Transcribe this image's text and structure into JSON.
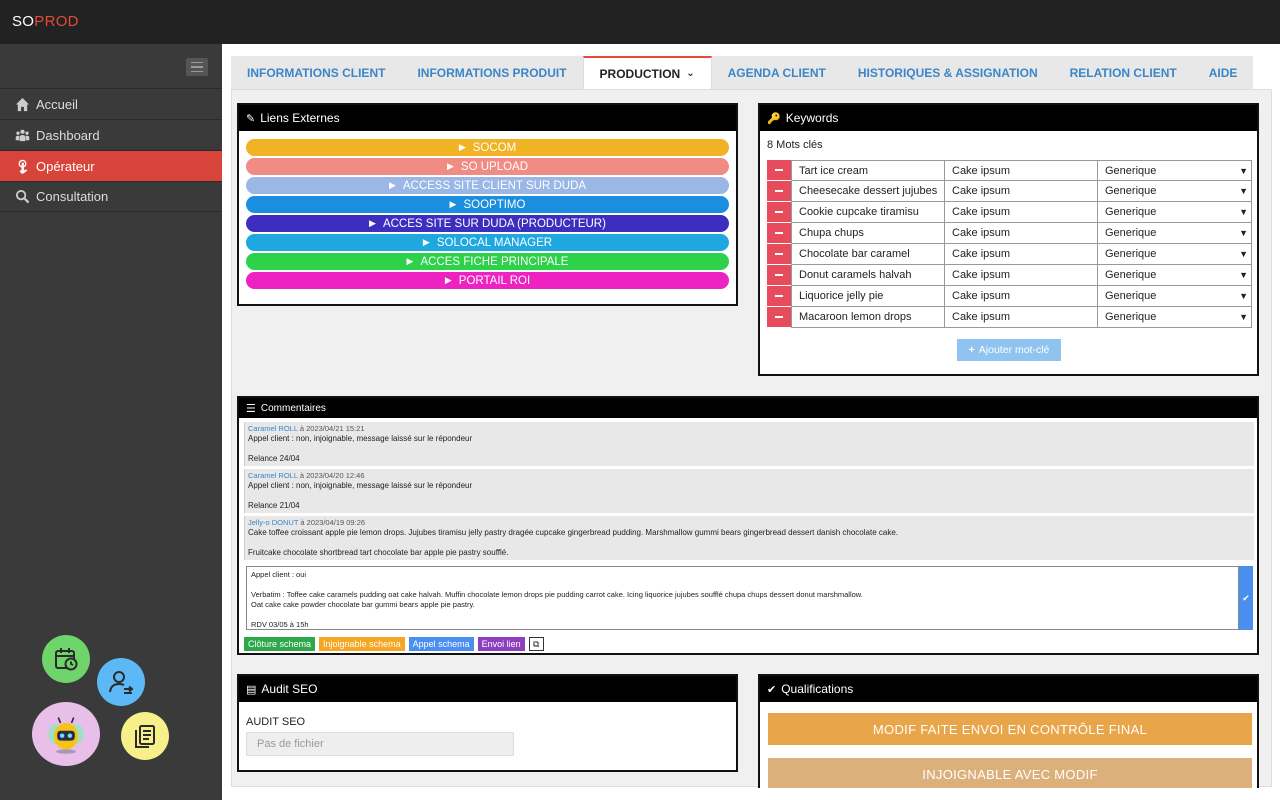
{
  "app": {
    "logo_so": "SO",
    "logo_prod": "PROD"
  },
  "sidebar": {
    "items": [
      {
        "label": "Accueil",
        "icon": "home-icon"
      },
      {
        "label": "Dashboard",
        "icon": "users-icon"
      },
      {
        "label": "Opérateur",
        "icon": "operator-icon",
        "active": true
      },
      {
        "label": "Consultation",
        "icon": "search-icon"
      }
    ]
  },
  "tabs": [
    {
      "label": "INFORMATIONS CLIENT"
    },
    {
      "label": "INFORMATIONS PRODUIT"
    },
    {
      "label": "PRODUCTION",
      "active": true
    },
    {
      "label": "AGENDA CLIENT"
    },
    {
      "label": "HISTORIQUES & ASSIGNATION"
    },
    {
      "label": "RELATION CLIENT"
    },
    {
      "label": "AIDE"
    }
  ],
  "liens": {
    "title": "Liens Externes",
    "items": [
      {
        "label": "SOCOM",
        "color": "#f0b323"
      },
      {
        "label": "SO UPLOAD",
        "color": "#f08c84"
      },
      {
        "label": "ACCESS SITE CLIENT SUR DUDA",
        "color": "#9bb7e6"
      },
      {
        "label": "SOOPTIMO",
        "color": "#1a8fe0"
      },
      {
        "label": "ACCES SITE SUR DUDA (PRODUCTEUR)",
        "color": "#3c2fc0"
      },
      {
        "label": "SOLOCAL MANAGER",
        "color": "#1fa8e0"
      },
      {
        "label": "ACCES FICHE PRINCIPALE",
        "color": "#2ed14a"
      },
      {
        "label": "PORTAIL ROI",
        "color": "#ee22c0"
      }
    ]
  },
  "keywords": {
    "title": "Keywords",
    "count_label": "8 Mots clés",
    "rows": [
      {
        "keyword": "Tart ice cream",
        "category": "Cake ipsum",
        "type": "Generique"
      },
      {
        "keyword": "Cheesecake dessert jujubes",
        "category": "Cake ipsum",
        "type": "Generique"
      },
      {
        "keyword": "Cookie cupcake tiramisu",
        "category": "Cake ipsum",
        "type": "Generique"
      },
      {
        "keyword": "Chupa chups",
        "category": "Cake ipsum",
        "type": "Generique"
      },
      {
        "keyword": "Chocolate bar caramel",
        "category": "Cake ipsum",
        "type": "Generique"
      },
      {
        "keyword": "Donut caramels halvah",
        "category": "Cake ipsum",
        "type": "Generique"
      },
      {
        "keyword": "Liquorice jelly pie",
        "category": "Cake ipsum",
        "type": "Generique"
      },
      {
        "keyword": "Macaroon lemon drops",
        "category": "Cake ipsum",
        "type": "Generique"
      }
    ],
    "add_label": "Ajouter mot-clé"
  },
  "commentaires": {
    "title": "Commentaires",
    "items": [
      {
        "author": "Caramel ROLL",
        "date": "à 2023/04/21 15:21",
        "line1": "Appel client : non, injoignable, message laissé sur le répondeur",
        "line2": "Relance 24/04"
      },
      {
        "author": "Caramel ROLL",
        "date": "à 2023/04/20 12:46",
        "line1": "Appel client : non, injoignable, message laissé sur le répondeur",
        "line2": "Relance 21/04"
      },
      {
        "author": "Jelly-o DONUT",
        "date": "à 2023/04/19 09:26",
        "line1": "Cake toffee croissant apple pie lemon drops. Jujubes tiramisu jelly pastry dragée cupcake gingerbread pudding. Marshmallow gummi bears gingerbread dessert danish chocolate cake.",
        "line2": "Fruitcake chocolate shortbread tart chocolate bar apple pie pastry soufflé."
      }
    ],
    "draft": {
      "l1": "Appel client : oui",
      "l2": "Verbatim : Toffee cake caramels pudding oat cake halvah. Muffin chocolate lemon drops pie pudding carrot cake. Icing liquorice jujubes soufflé chupa chups dessert donut marshmallow.",
      "l3": "Oat cake cake powder chocolate bar gummi bears apple pie pastry.",
      "l4": "RDV 03/05 à 15h"
    },
    "buttons": [
      {
        "label": "Clôture schema",
        "color": "#2ea84a"
      },
      {
        "label": "Injoignable schema",
        "color": "#f5a623"
      },
      {
        "label": "Appel schema",
        "color": "#4a8ef0"
      },
      {
        "label": "Envoi lien",
        "color": "#8e3fbf"
      }
    ]
  },
  "audit": {
    "title": "Audit SEO",
    "label": "AUDIT SEO",
    "file_placeholder": "Pas de fichier"
  },
  "qualifications": {
    "title": "Qualifications",
    "buttons": [
      {
        "label": "MODIF FAITE ENVOI EN CONTRÔLE FINAL",
        "color": "#e9a54a"
      },
      {
        "label": "INJOIGNABLE AVEC MODIF",
        "color": "#dbb07a"
      }
    ]
  }
}
